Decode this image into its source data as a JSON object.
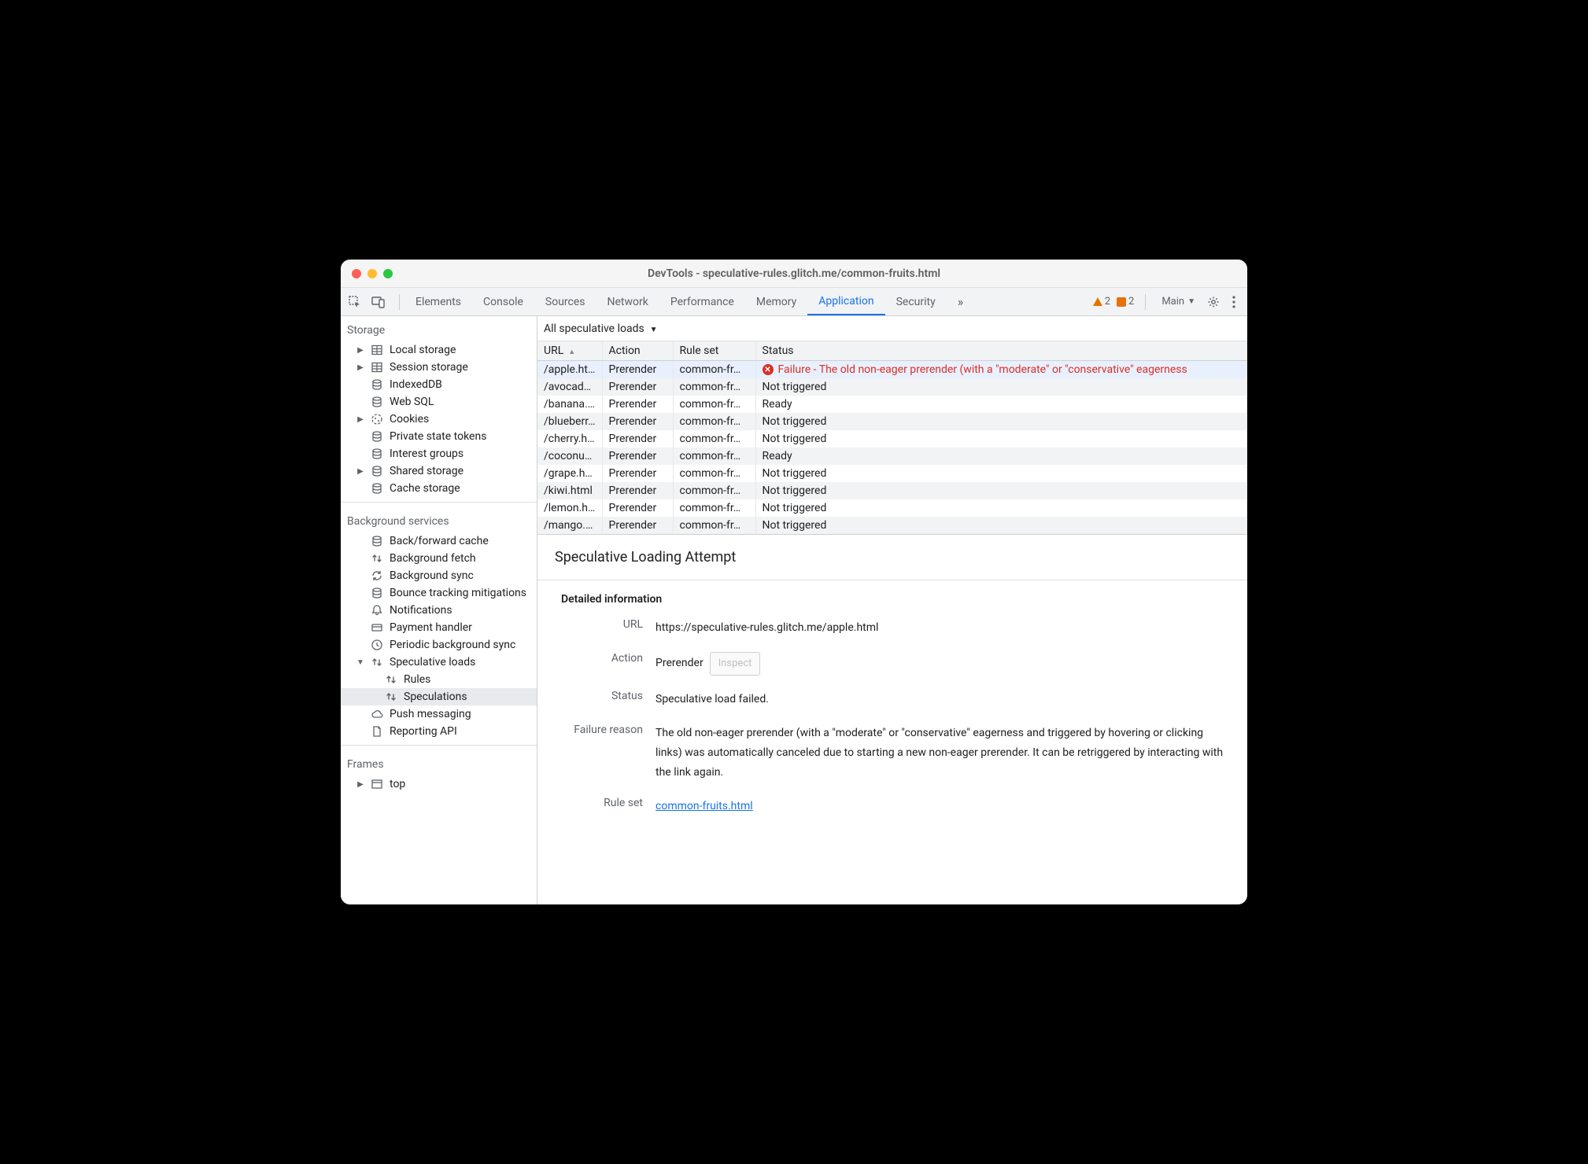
{
  "window": {
    "title": "DevTools - speculative-rules.glitch.me/common-fruits.html"
  },
  "tabs": [
    "Elements",
    "Console",
    "Sources",
    "Network",
    "Performance",
    "Memory",
    "Application",
    "Security"
  ],
  "active_tab": "Application",
  "more_tabs_icon": "»",
  "warn1": "2",
  "warn2": "2",
  "main_dropdown": "Main",
  "sidebar": {
    "storage_title": "Storage",
    "storage_items": [
      {
        "label": "Local storage",
        "icon": "db-grid",
        "arrow": true
      },
      {
        "label": "Session storage",
        "icon": "db-grid",
        "arrow": true
      },
      {
        "label": "IndexedDB",
        "icon": "db"
      },
      {
        "label": "Web SQL",
        "icon": "db"
      },
      {
        "label": "Cookies",
        "icon": "cookie",
        "arrow": true
      },
      {
        "label": "Private state tokens",
        "icon": "db"
      },
      {
        "label": "Interest groups",
        "icon": "db"
      },
      {
        "label": "Shared storage",
        "icon": "db",
        "arrow": true
      },
      {
        "label": "Cache storage",
        "icon": "db"
      }
    ],
    "bg_title": "Background services",
    "bg_items": [
      {
        "label": "Back/forward cache",
        "icon": "db"
      },
      {
        "label": "Background fetch",
        "icon": "updown"
      },
      {
        "label": "Background sync",
        "icon": "sync"
      },
      {
        "label": "Bounce tracking mitigations",
        "icon": "db"
      },
      {
        "label": "Notifications",
        "icon": "bell"
      },
      {
        "label": "Payment handler",
        "icon": "card"
      },
      {
        "label": "Periodic background sync",
        "icon": "clock"
      },
      {
        "label": "Speculative loads",
        "icon": "updown",
        "arrow": true,
        "arrow_open": true
      },
      {
        "label": "Rules",
        "icon": "updown",
        "sub": true
      },
      {
        "label": "Speculations",
        "icon": "updown",
        "sub": true,
        "selected": true
      },
      {
        "label": "Push messaging",
        "icon": "cloud"
      },
      {
        "label": "Reporting API",
        "icon": "doc"
      }
    ],
    "frames_title": "Frames",
    "frames_items": [
      {
        "label": "top",
        "icon": "frame",
        "arrow": true
      }
    ]
  },
  "content_toolbar_label": "All speculative loads",
  "table": {
    "headers": [
      "URL",
      "Action",
      "Rule set",
      "Status"
    ],
    "rows": [
      {
        "url": "/apple.html",
        "action": "Prerender",
        "ruleset": "common-fr…",
        "status": "Failure - The old non-eager prerender (with a \"moderate\" or \"conservative\" eagerness",
        "error": true,
        "selected": true
      },
      {
        "url": "/avocad…",
        "action": "Prerender",
        "ruleset": "common-fr…",
        "status": "Not triggered"
      },
      {
        "url": "/banana.…",
        "action": "Prerender",
        "ruleset": "common-fr…",
        "status": "Ready"
      },
      {
        "url": "/blueberr…",
        "action": "Prerender",
        "ruleset": "common-fr…",
        "status": "Not triggered"
      },
      {
        "url": "/cherry.h…",
        "action": "Prerender",
        "ruleset": "common-fr…",
        "status": "Not triggered"
      },
      {
        "url": "/coconut…",
        "action": "Prerender",
        "ruleset": "common-fr…",
        "status": "Ready"
      },
      {
        "url": "/grape.html",
        "action": "Prerender",
        "ruleset": "common-fr…",
        "status": "Not triggered"
      },
      {
        "url": "/kiwi.html",
        "action": "Prerender",
        "ruleset": "common-fr…",
        "status": "Not triggered"
      },
      {
        "url": "/lemon.h…",
        "action": "Prerender",
        "ruleset": "common-fr…",
        "status": "Not triggered"
      },
      {
        "url": "/mango.…",
        "action": "Prerender",
        "ruleset": "common-fr…",
        "status": "Not triggered"
      }
    ]
  },
  "detail": {
    "title": "Speculative Loading Attempt",
    "section_title": "Detailed information",
    "url_label": "URL",
    "url_value": "https://speculative-rules.glitch.me/apple.html",
    "action_label": "Action",
    "action_value": "Prerender",
    "inspect_label": "Inspect",
    "status_label": "Status",
    "status_value": "Speculative load failed.",
    "failure_label": "Failure reason",
    "failure_value": "The old non-eager prerender (with a \"moderate\" or \"conservative\" eagerness and triggered by hovering or clicking links) was automatically canceled due to starting a new non-eager prerender. It can be retriggered by interacting with the link again.",
    "ruleset_label": "Rule set",
    "ruleset_value": "common-fruits.html"
  }
}
